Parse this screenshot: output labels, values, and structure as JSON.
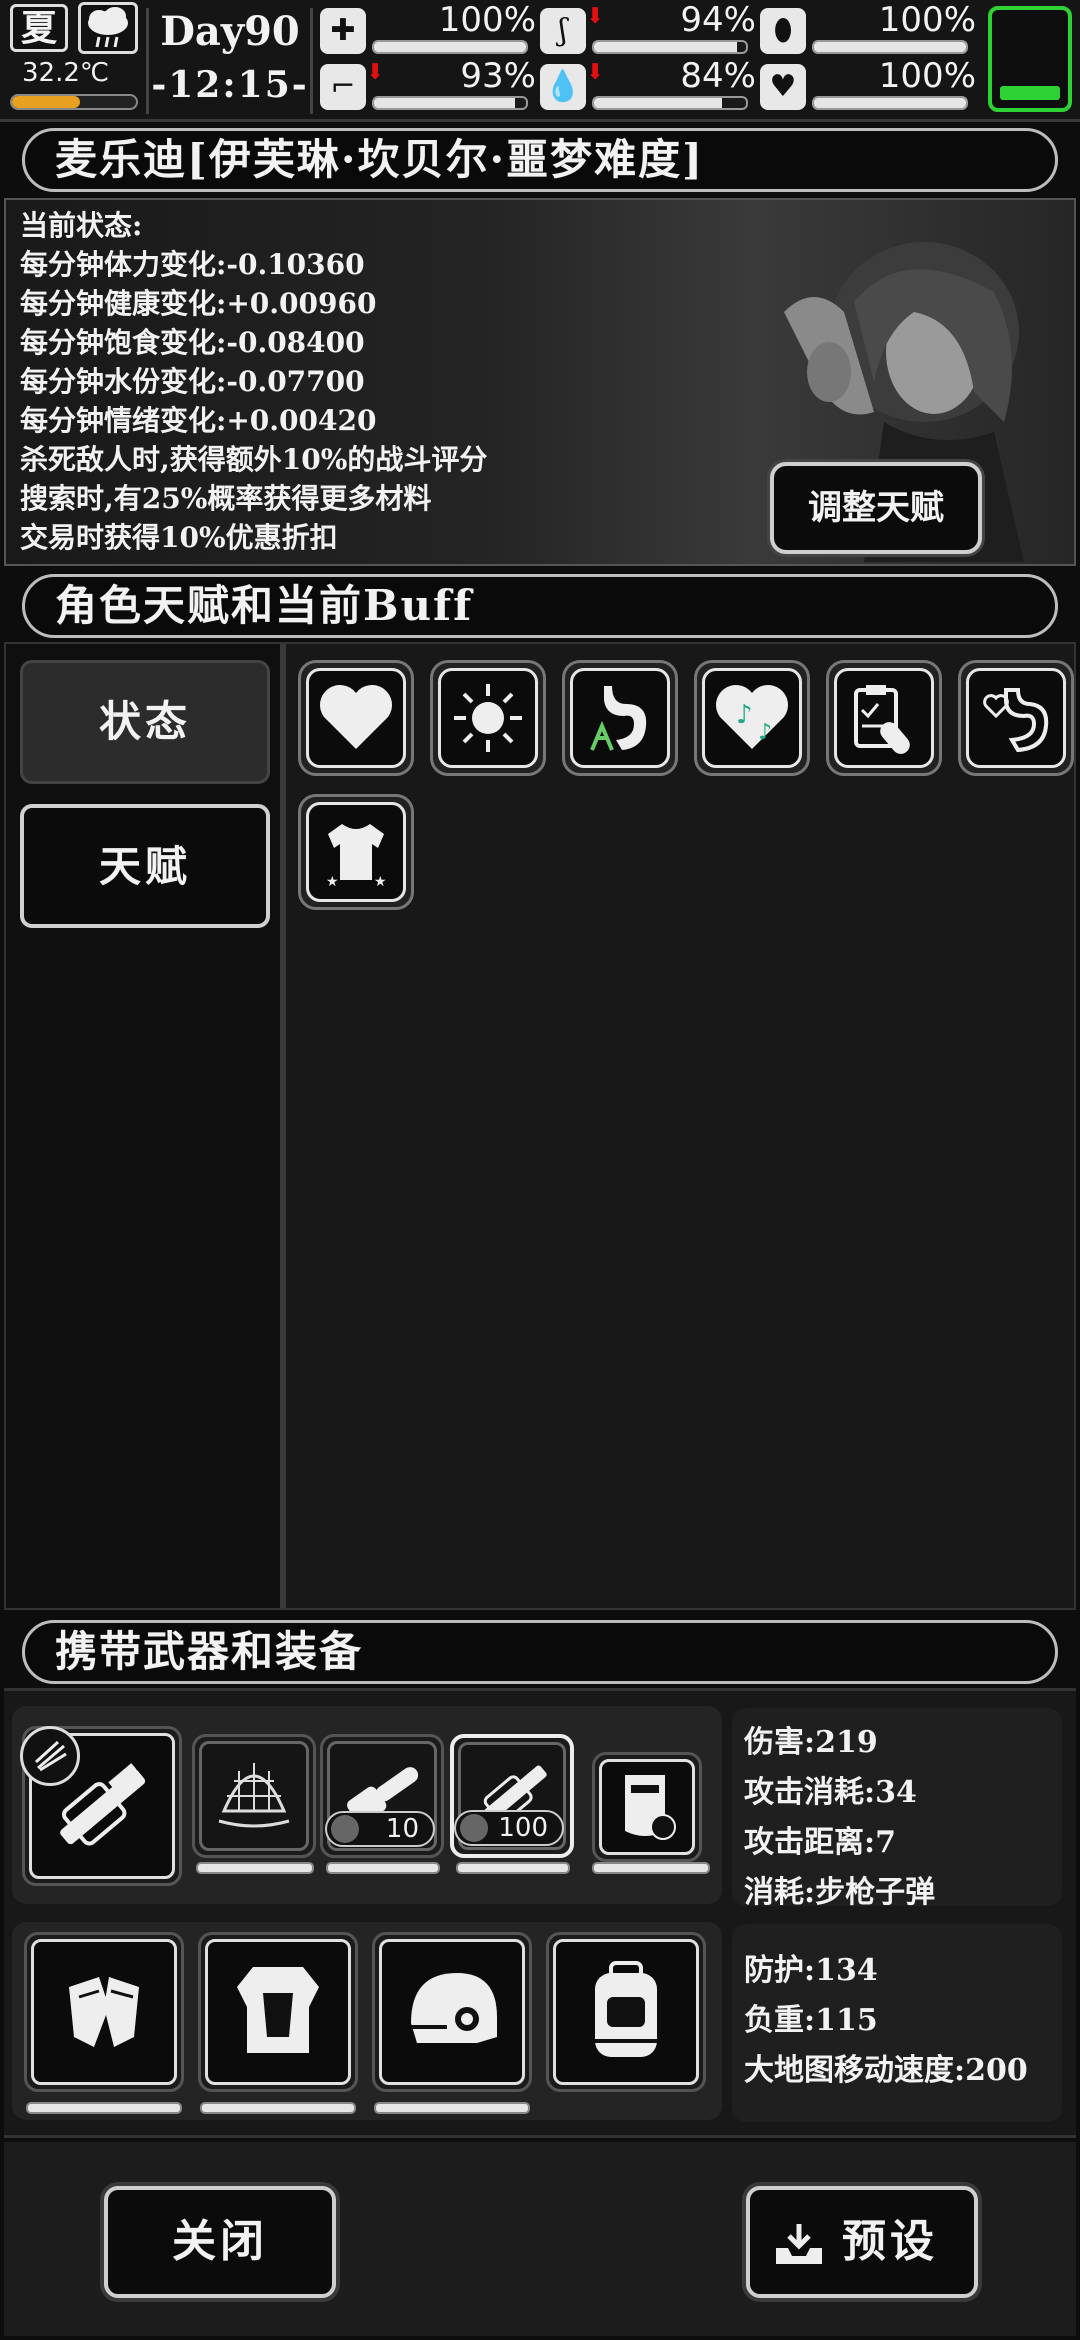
{
  "hud": {
    "season": "夏",
    "temperature": "32.2℃",
    "temperature_level": 0.55,
    "day": "Day90",
    "time": "-12:15-",
    "stats": [
      {
        "icon": "medkit-icon",
        "value": "100%",
        "level": 1.0,
        "down": false
      },
      {
        "icon": "stomach-icon",
        "value": "94%",
        "level": 0.94,
        "down": true
      },
      {
        "icon": "capsule-icon",
        "value": "100%",
        "level": 1.0,
        "down": false
      },
      {
        "icon": "boot-icon",
        "value": "93%",
        "level": 0.93,
        "down": true
      },
      {
        "icon": "water-drop-icon",
        "value": "84%",
        "level": 0.84,
        "down": true
      },
      {
        "icon": "heart-icon",
        "value": "100%",
        "level": 1.0,
        "down": false
      }
    ],
    "battery_level": 0.15,
    "battery_color": "#2fd235"
  },
  "character": {
    "title": "麦乐迪[伊芙琳·坎贝尔·噩梦难度]",
    "lines": [
      "当前状态:",
      "每分钟体力变化:-0.10360",
      "每分钟健康变化:+0.00960",
      "每分钟饱食变化:-0.08400",
      "每分钟水份变化:-0.07700",
      "每分钟情绪变化:+0.00420",
      "杀死敌人时,获得额外10%的战斗评分",
      "搜索时,有25%概率获得更多材料",
      "交易时获得10%优惠折扣"
    ],
    "talent_button": "调整天赋"
  },
  "buff": {
    "title": "角色天赋和当前Buff",
    "tabs": [
      "状态",
      "天赋"
    ],
    "icons": [
      "heart-buff-icon",
      "sun-buff-icon",
      "stomach-plant-buff-icon",
      "music-heart-buff-icon",
      "clipboard-pill-buff-icon",
      "heart-stomach-buff-icon",
      "shirt-buff-icon"
    ]
  },
  "equipment": {
    "title": "携带武器和装备",
    "counts": [
      "10",
      "100"
    ],
    "weapon_stats": [
      "伤害:219",
      "攻击消耗:34",
      "攻击距离:7",
      "消耗:步枪子弹"
    ],
    "armor_stats": [
      "防护:134",
      "负重:115",
      "大地图移动速度:200"
    ]
  },
  "bottom": {
    "close": "关闭",
    "preset": "预设"
  }
}
